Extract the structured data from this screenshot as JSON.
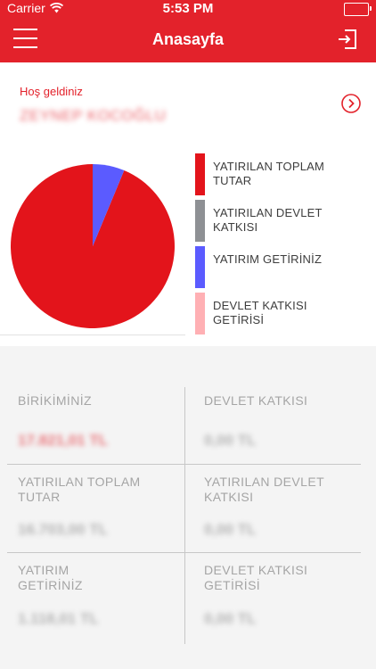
{
  "status_bar": {
    "carrier": "Carrier",
    "time": "5:53 PM"
  },
  "header": {
    "title": "Anasayfa",
    "menu_icon": "hamburger-menu-icon",
    "logout_icon": "logout-icon",
    "background_color": "#e3222b"
  },
  "welcome": {
    "label": "Hoş geldiniz",
    "user_name": "ZEYNEP KOCOĞLU",
    "detail_icon": "chevron-right-circle-icon"
  },
  "chart_data": {
    "type": "pie",
    "slices": [
      {
        "name": "YATIRILAN TOPLAM TUTAR",
        "value": 16703.0,
        "color": "#e3141b"
      },
      {
        "name": "YATIRILAN DEVLET KATKISI",
        "value": 0.0,
        "color": "#8e9094"
      },
      {
        "name": "YATIRIM GETİRİNİZ",
        "value": 1118.01,
        "color": "#5b5bff"
      },
      {
        "name": "DEVLET KATKISI GETİRİSİ",
        "value": 0.0,
        "color": "#ffb0b4"
      }
    ]
  },
  "legend": {
    "items": [
      {
        "label": "YATIRILAN TOPLAM TUTAR",
        "color": "#e3141b"
      },
      {
        "label": "YATIRILAN DEVLET KATKISI",
        "color": "#8e9094"
      },
      {
        "label": "YATIRIM GETİRİNİZ",
        "color": "#5b5bff"
      },
      {
        "label": "DEVLET KATKISI GETİRİSİ",
        "color": "#ffb0b4"
      }
    ]
  },
  "stats": {
    "cells": [
      {
        "label": "BİRİKİMİNİZ",
        "value": "17.821,01 TL",
        "highlight": true
      },
      {
        "label": "DEVLET KATKISI",
        "value": "0,00 TL",
        "highlight": false
      },
      {
        "label": "YATIRILAN TOPLAM TUTAR",
        "value": "16.703,00 TL",
        "highlight": false
      },
      {
        "label": "YATIRILAN DEVLET KATKISI",
        "value": "0,00 TL",
        "highlight": false
      },
      {
        "label": "YATIRIM GETİRİNİZ",
        "value": "1.118,01 TL",
        "highlight": false
      },
      {
        "label": "DEVLET KATKISI GETİRİSİ",
        "value": "0,00 TL",
        "highlight": false
      }
    ]
  }
}
